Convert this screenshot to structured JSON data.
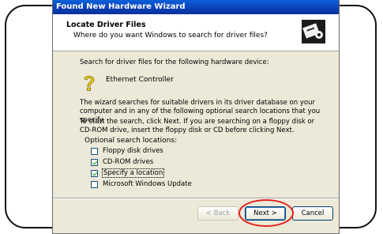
{
  "window": {
    "title": "Found New Hardware Wizard"
  },
  "header": {
    "title": "Locate Driver Files",
    "subtitle": "Where do you want Windows to search for driver files?"
  },
  "content": {
    "intro": "Search for driver files for the following hardware device:",
    "device_name": "Ethernet Controller",
    "paragraph1": "The wizard searches for suitable drivers in its driver database on your computer and in any of the following optional search locations that you specify.",
    "paragraph2": "To start the search, click Next. If you are searching on a floppy disk or CD-ROM drive, insert the floppy disk or CD before clicking Next.",
    "optional_label": "Optional search locations:",
    "options": [
      {
        "label": "Floppy disk drives",
        "checked": false
      },
      {
        "label": "CD-ROM drives",
        "checked": true
      },
      {
        "label": "Specify a location",
        "checked": true
      },
      {
        "label": "Microsoft Windows Update",
        "checked": false
      }
    ]
  },
  "buttons": {
    "back": "< Back",
    "next": "Next >",
    "cancel": "Cancel"
  },
  "icons": {
    "wizard": "hardware-wizard-icon",
    "device": "device-question-icon"
  },
  "colors": {
    "titlebar": "#0a3fb8",
    "highlight": "#e3201b",
    "dialog_bg": "#ece9d8"
  }
}
